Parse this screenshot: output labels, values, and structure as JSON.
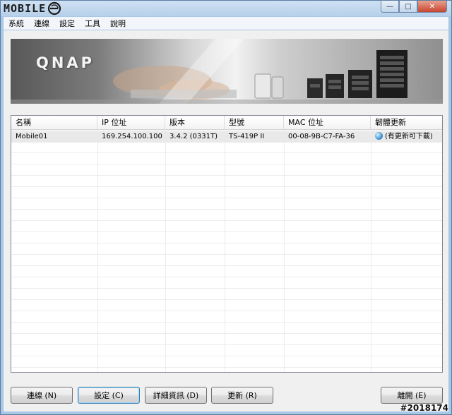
{
  "window": {
    "brand": "MOBILE",
    "buttons": {
      "minimize": "—",
      "maximize": "□",
      "close": "✕"
    }
  },
  "menu": [
    "系統",
    "連線",
    "設定",
    "工具",
    "說明"
  ],
  "banner": {
    "logo": "QNAP"
  },
  "table": {
    "columns": [
      "名稱",
      "IP 位址",
      "版本",
      "型號",
      "MAC 位址",
      "韌體更新"
    ],
    "rows": [
      {
        "name": "Mobile01",
        "ip": "169.254.100.100",
        "version": "3.4.2 (0331T)",
        "model": "TS-419P II",
        "mac": "00-08-9B-C7-FA-36",
        "firmware": "(有更新可下載)"
      }
    ]
  },
  "buttons": {
    "connect": "連線 (N)",
    "settings": "設定 (C)",
    "details": "詳細資訊 (D)",
    "refresh": "更新 (R)",
    "exit": "離開 (E)"
  },
  "watermark": "#2018174",
  "colors": {
    "title_bar": "#b6d0ea",
    "selected_row": "#e9e9e9",
    "accent": "#3c7fb1"
  },
  "icons": {
    "firmware_status": "info-globe-icon",
    "brand_mark": "e-logo-icon"
  }
}
